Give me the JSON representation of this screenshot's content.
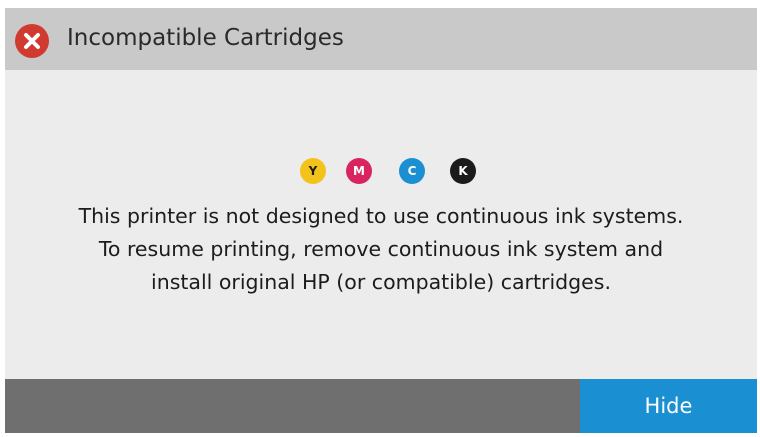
{
  "dialog": {
    "title": "Incompatible Cartridges",
    "icon": "error-x-icon",
    "accent_color": "#d13a2f"
  },
  "cartridges": [
    {
      "letter": "Y",
      "color": "#f3c31c",
      "text_color": "#1c1c1c"
    },
    {
      "letter": "M",
      "color": "#d9245f",
      "text_color": "#ffffff"
    },
    {
      "letter": "C",
      "color": "#1a8fd1",
      "text_color": "#ffffff"
    },
    {
      "letter": "K",
      "color": "#1b1b1b",
      "text_color": "#ffffff"
    }
  ],
  "message": {
    "line1": "This printer is not designed to use continuous ink systems.",
    "line2": "To resume printing, remove continuous ink system and",
    "line3": "install original HP (or compatible) cartridges."
  },
  "footer": {
    "hide_label": "Hide",
    "button_color": "#1a8fd1"
  }
}
